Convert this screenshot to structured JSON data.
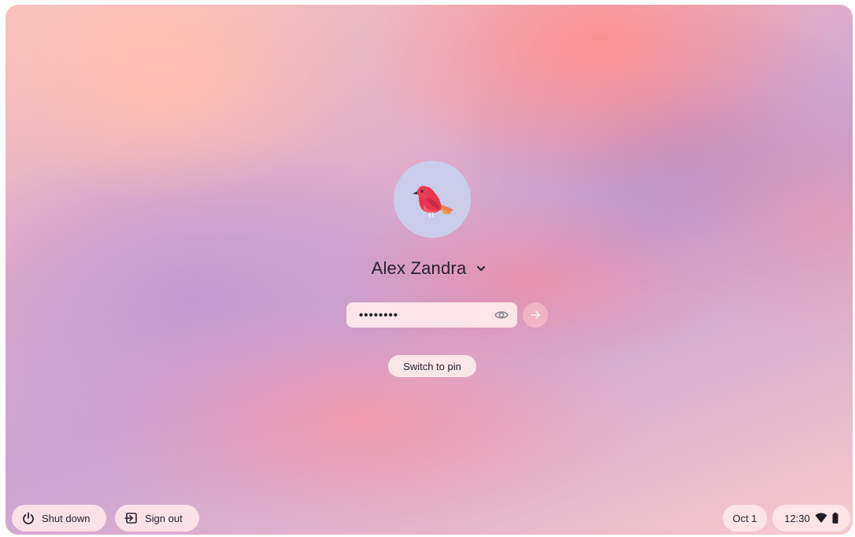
{
  "user": {
    "name": "Alex Zandra",
    "password_masked": "••••••••"
  },
  "actions": {
    "switch_to_pin": "Switch to pin"
  },
  "shelf": {
    "shutdown_label": "Shut down",
    "signout_label": "Sign out",
    "date": "Oct 1",
    "time": "12:30"
  },
  "icons": {
    "avatar": "bird-icon",
    "user_menu": "chevron-down-icon",
    "password_toggle": "eye-icon",
    "submit": "arrow-right-icon",
    "shutdown": "power-icon",
    "signout": "sign-out-icon",
    "wifi": "wifi-icon",
    "battery": "battery-icon"
  },
  "colors": {
    "avatar_bg": "#c9cde8",
    "bird": "#e8344e",
    "text": "#2a2230"
  }
}
